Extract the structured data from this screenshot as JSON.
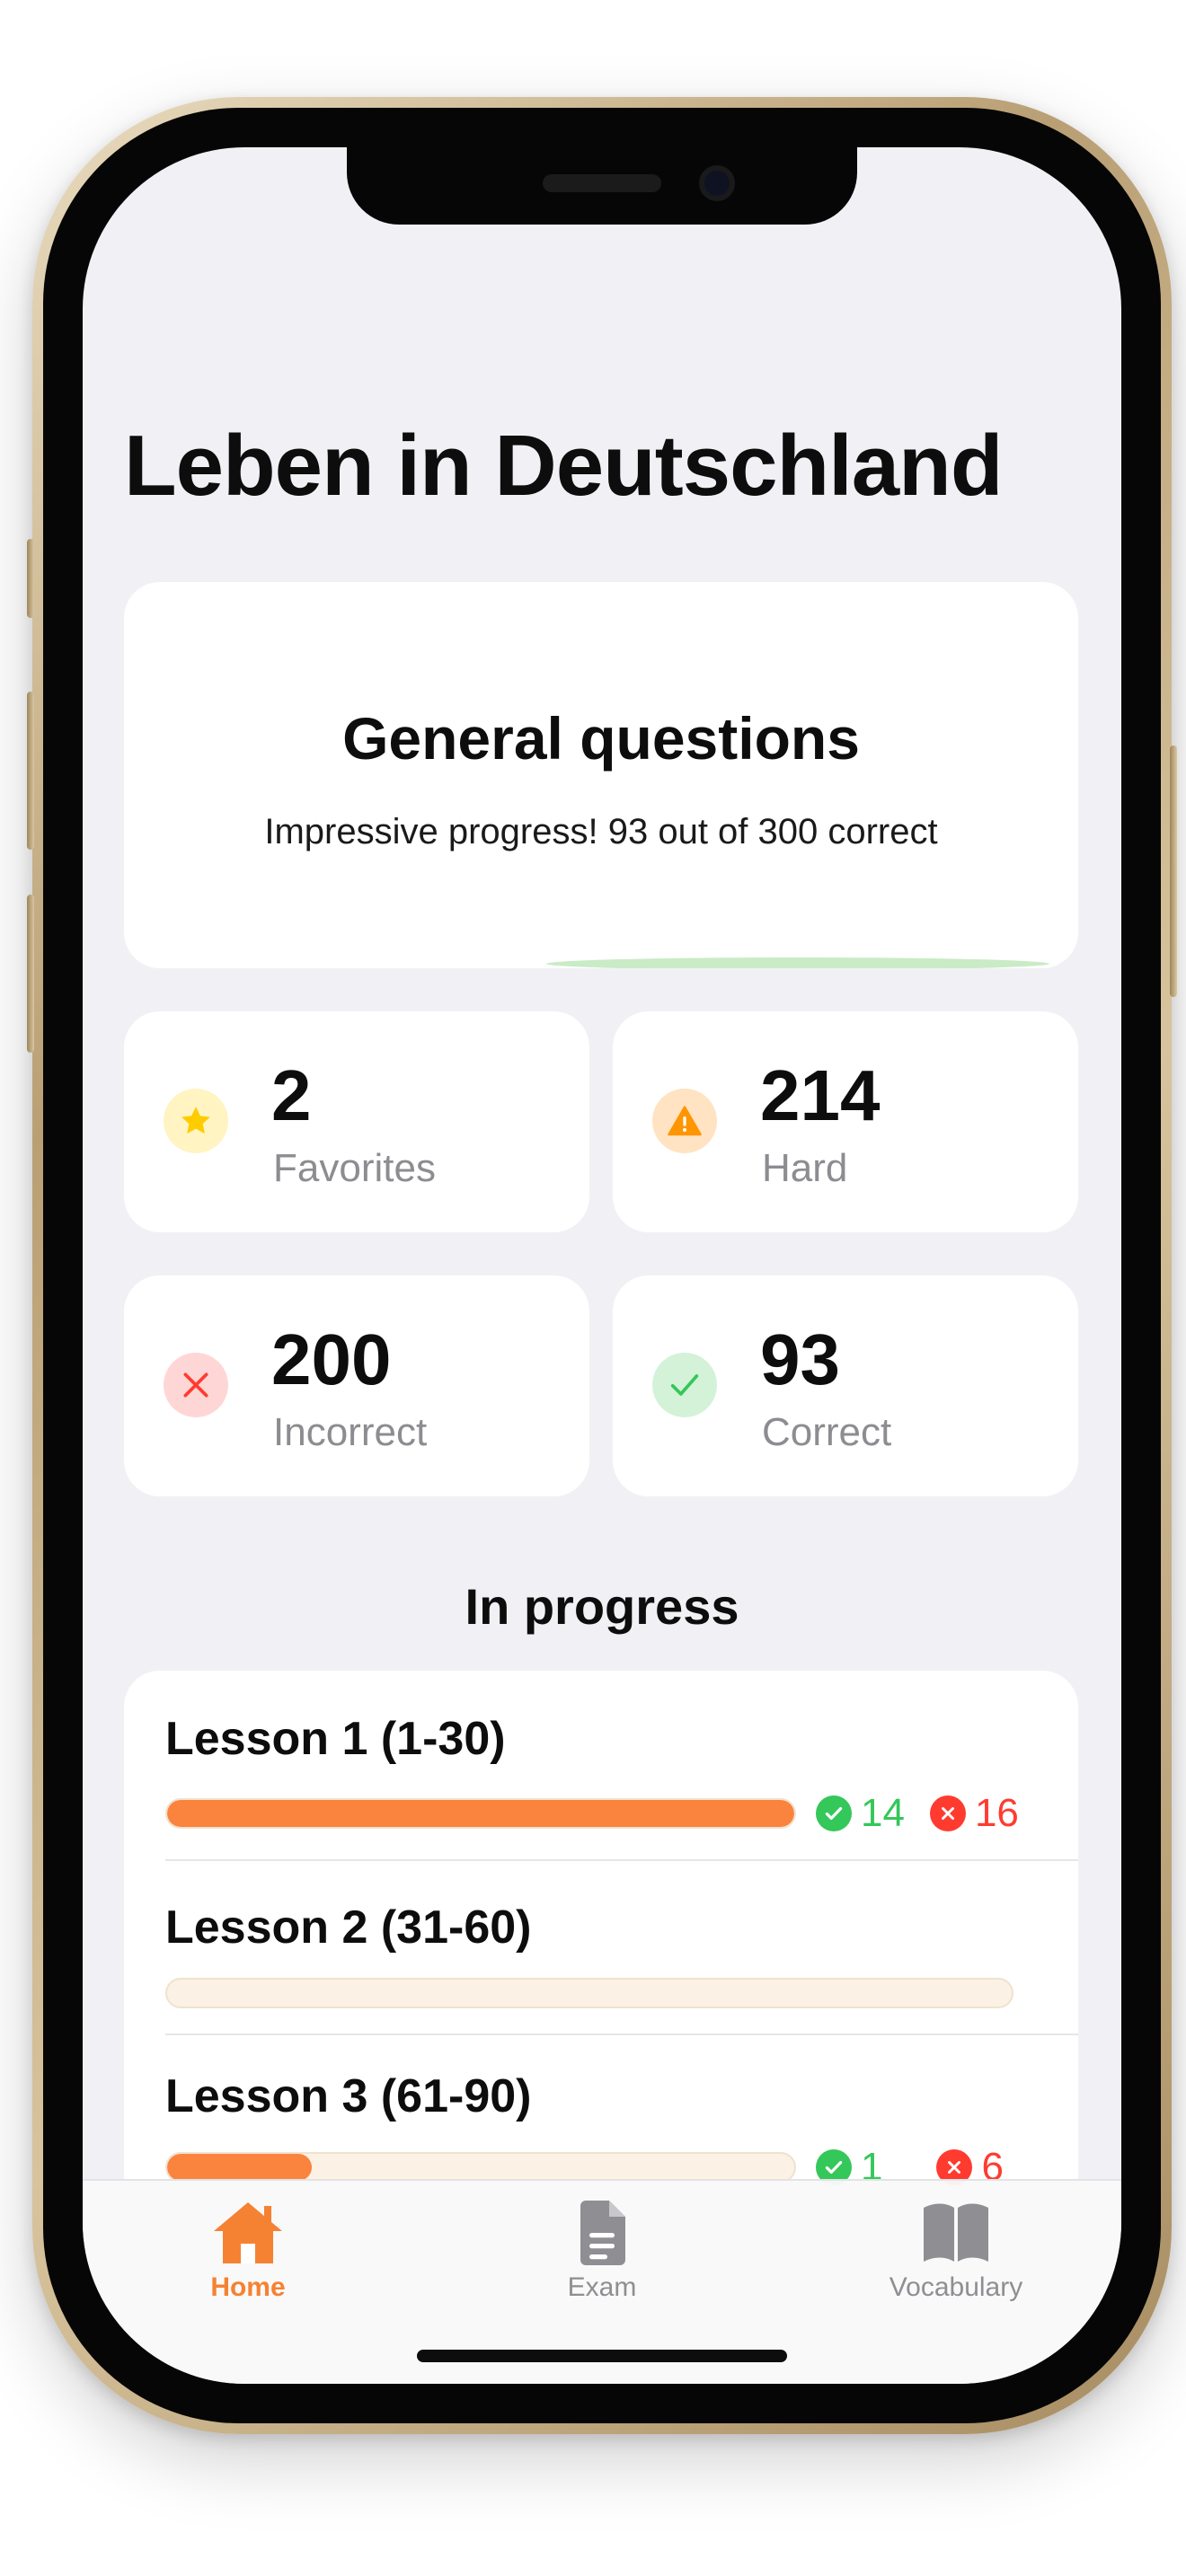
{
  "app": {
    "title": "Leben in Deutschland"
  },
  "general": {
    "title": "General questions",
    "subtitle": "Impressive progress! 93 out of 300 correct",
    "progress": 0.31
  },
  "stats": [
    {
      "value": "2",
      "label": "Favorites",
      "icon": "star-icon",
      "color": "#ffcc00",
      "bg": "#fff4c2"
    },
    {
      "value": "214",
      "label": "Hard",
      "icon": "warning-icon",
      "color": "#ff9500",
      "bg": "#ffe3c2"
    },
    {
      "value": "200",
      "label": "Incorrect",
      "icon": "x-icon",
      "color": "#ff3b30",
      "bg": "#ffd6d6"
    },
    {
      "value": "93",
      "label": "Correct",
      "icon": "checkmark-icon",
      "color": "#34c759",
      "bg": "#d3f2d8"
    }
  ],
  "in_progress": {
    "title": "In progress",
    "lessons": [
      {
        "title": "Lesson 1 (1-30)",
        "progress": 1.0,
        "correct": "14",
        "incorrect": "16"
      },
      {
        "title": "Lesson 2 (31-60)",
        "progress": 0.0,
        "correct": "",
        "incorrect": ""
      },
      {
        "title": "Lesson 3 (61-90)",
        "progress": 0.23,
        "correct": "1",
        "incorrect": "6"
      }
    ]
  },
  "tabbar": {
    "items": [
      {
        "label": "Home",
        "icon": "house-icon",
        "active": true
      },
      {
        "label": "Exam",
        "icon": "document-icon",
        "active": false
      },
      {
        "label": "Vocabulary",
        "icon": "book-icon",
        "active": false
      }
    ]
  },
  "colors": {
    "accent": "#fa843d",
    "correct": "#34c759",
    "incorrect": "#ff3b30"
  }
}
